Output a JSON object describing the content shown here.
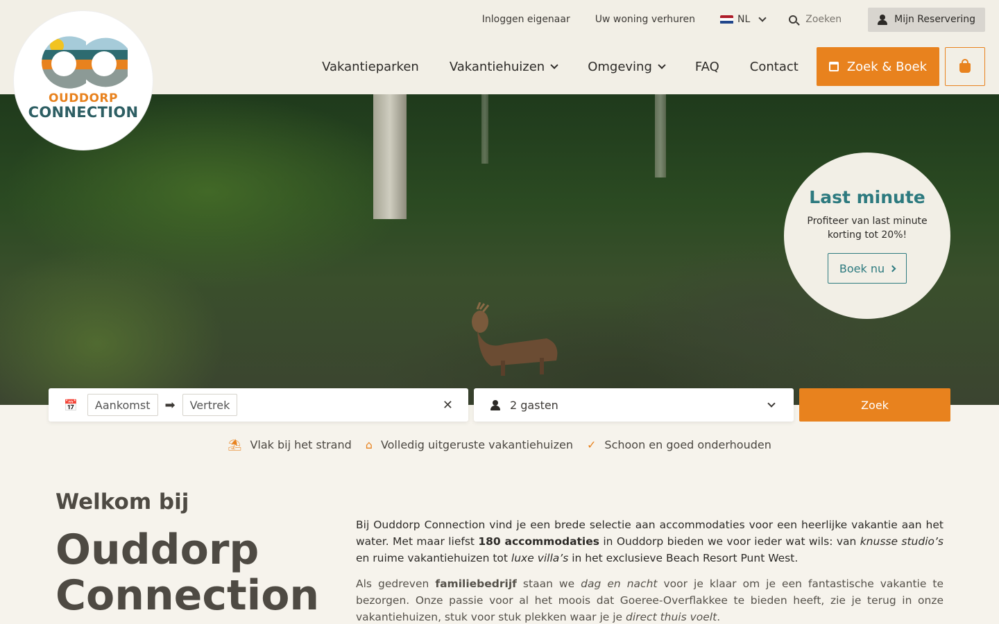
{
  "topbar": {
    "login_owner": "Inloggen eigenaar",
    "rent_out": "Uw woning verhuren",
    "language": "NL",
    "search_placeholder": "Zoeken",
    "reservation": "Mijn Reservering"
  },
  "logo": {
    "line1": "OUDDORP",
    "line2": "CONNECTION"
  },
  "nav": {
    "items": [
      "Vakantieparken",
      "Vakantiehuizen",
      "Omgeving",
      "FAQ",
      "Contact"
    ],
    "cta": "Zoek & Boek"
  },
  "last_minute": {
    "title": "Last minute",
    "text": "Profiteer van last minute korting tot 20%!",
    "button": "Boek nu"
  },
  "search": {
    "arrival": "Aankomst",
    "departure": "Vertrek",
    "guests": "2 gasten",
    "submit": "Zoek"
  },
  "usps": [
    "Vlak bij het strand",
    "Volledig uitgeruste vakantiehuizen",
    "Schoon en goed onderhouden"
  ],
  "welcome": {
    "small": "Welkom bij",
    "big1": "Ouddorp",
    "big2": "Connection",
    "p1_a": "Bij Ouddorp Connection vind je een brede selectie aan accommodaties voor een heerlijke vakantie aan het water. Met maar liefst ",
    "p1_b": "180 accommodaties",
    "p1_c": " in Ouddorp bieden we voor ieder wat wils: van ",
    "p1_d": "knusse studio’s",
    "p1_e": " en ruime vakantiehuizen tot ",
    "p1_f": "luxe villa’s",
    "p1_g": " in het exclusieve Beach Resort Punt West.",
    "p2_a": "Als gedreven ",
    "p2_b": "familiebedrijf",
    "p2_c": " staan we ",
    "p2_d": "dag en nacht",
    "p2_e": " voor je klaar om je een fantastische vakantie te bezorgen. Onze passie voor al het moois dat Goeree-Overflakkee te bieden heeft, zie je terug in onze vakantiehuizen, stuk voor stuk plekken waar je je ",
    "p2_f": "direct thuis voelt",
    "p2_g": "."
  },
  "colors": {
    "accent": "#e8821e",
    "teal": "#2d7a7f",
    "header_bg": "#f2efe6"
  }
}
